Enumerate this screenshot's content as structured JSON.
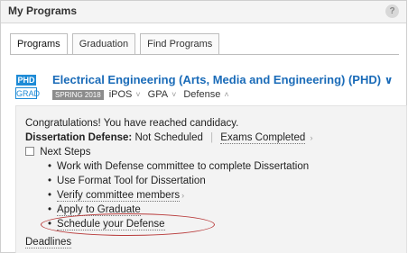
{
  "panel": {
    "title": "My Programs",
    "help_icon": "?"
  },
  "tabs": [
    {
      "label": "Programs",
      "active": true
    },
    {
      "label": "Graduation",
      "active": false
    },
    {
      "label": "Find Programs",
      "active": false
    }
  ],
  "program": {
    "level_badge": "PHD",
    "career_badge": "GRAD",
    "title": "Electrical Engineering (Arts, Media and Engineering) (PHD)",
    "title_chevron": "∨",
    "term": "SPRING 2018",
    "links": [
      {
        "label": "iPOS",
        "caret": "˅"
      },
      {
        "label": "GPA",
        "caret": "˅"
      },
      {
        "label": "Defense",
        "caret": "˄"
      }
    ]
  },
  "defense": {
    "congrats": "Congratulations! You have reached candidacy.",
    "dissertation_label": "Dissertation Defense:",
    "dissertation_status": "Not Scheduled",
    "separator": "|",
    "exams": "Exams Completed",
    "exams_caret": "›",
    "next_steps_label": "Next Steps",
    "steps": [
      {
        "text": "Work with Defense committee to complete Dissertation",
        "dotted": false
      },
      {
        "text": "Use Format Tool for Dissertation",
        "dotted": false
      },
      {
        "text": "Verify committee members",
        "dotted": true
      },
      {
        "text": "Apply to Graduate",
        "dotted": true
      },
      {
        "text": "Schedule your Defense",
        "dotted": true
      }
    ],
    "bullet": "•",
    "deadlines": "Deadlines"
  },
  "colors": {
    "accent": "#1a6bb8",
    "badge": "#1e8bd6",
    "highlight_oval": "#b83a3a"
  }
}
